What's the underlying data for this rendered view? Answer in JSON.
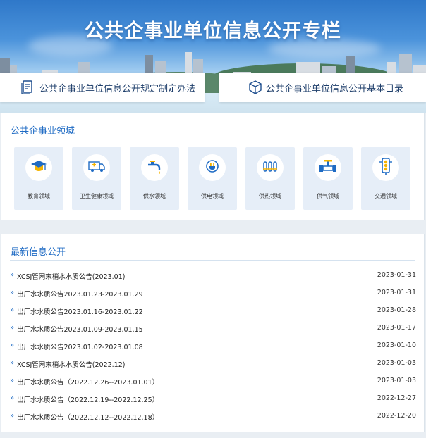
{
  "banner": {
    "title": "公共企事业单位信息公开专栏",
    "left_button": "公共企事业单位信息公开规定制定办法",
    "right_button": "公共企事业单位信息公开基本目录"
  },
  "fields": {
    "title": "公共企事业领域",
    "items": [
      {
        "label": "教育领域",
        "icon": "graduation-cap-icon"
      },
      {
        "label": "卫生健康领域",
        "icon": "ambulance-icon"
      },
      {
        "label": "供水领域",
        "icon": "water-tap-icon"
      },
      {
        "label": "供电领域",
        "icon": "power-plug-icon"
      },
      {
        "label": "供热领域",
        "icon": "radiator-icon"
      },
      {
        "label": "供气领域",
        "icon": "gas-valve-icon"
      },
      {
        "label": "交通领域",
        "icon": "traffic-light-icon"
      }
    ]
  },
  "news": {
    "title": "最新信息公开",
    "items": [
      {
        "title": "XCSJ管网末梢水水质公告(2023.01)",
        "date": "2023-01-31"
      },
      {
        "title": "出厂水水质公告2023.01.23-2023.01.29",
        "date": "2023-01-31"
      },
      {
        "title": "出厂水水质公告2023.01.16-2023.01.22",
        "date": "2023-01-28"
      },
      {
        "title": "出厂水水质公告2023.01.09-2023.01.15",
        "date": "2023-01-17"
      },
      {
        "title": "出厂水水质公告2023.01.02-2023.01.08",
        "date": "2023-01-10"
      },
      {
        "title": "XCSJ管网末梢水水质公告(2022.12)",
        "date": "2023-01-03"
      },
      {
        "title": "出厂水水质公告（2022.12.26--2023.01.01）",
        "date": "2023-01-03"
      },
      {
        "title": "出厂水水质公告（2022.12.19--2022.12.25）",
        "date": "2022-12-27"
      },
      {
        "title": "出厂水水质公告（2022.12.12--2022.12.18）",
        "date": "2022-12-20"
      }
    ]
  },
  "colors": {
    "accent": "#1f6bc4",
    "card_bg": "#e6eef8",
    "icon_blue": "#1f6bc4",
    "icon_yellow": "#f5b400"
  }
}
